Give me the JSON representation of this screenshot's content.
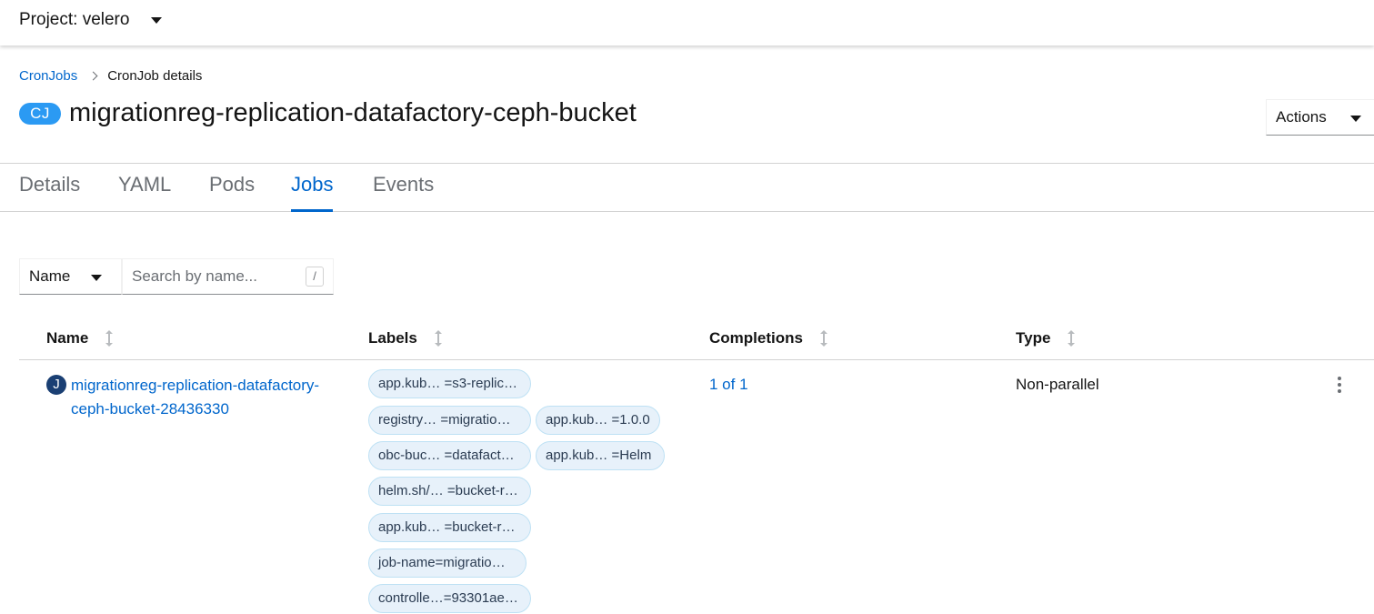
{
  "project": {
    "label": "Project: velero"
  },
  "breadcrumb": {
    "parent": "CronJobs",
    "current": "CronJob details"
  },
  "resource": {
    "badge": "CJ",
    "title": "migrationreg-replication-datafactory-ceph-bucket"
  },
  "actions": {
    "label": "Actions"
  },
  "tabs": [
    {
      "label": "Details"
    },
    {
      "label": "YAML"
    },
    {
      "label": "Pods"
    },
    {
      "label": "Jobs",
      "active": true
    },
    {
      "label": "Events"
    }
  ],
  "filter": {
    "type": "Name",
    "placeholder": "Search by name...",
    "shortcut": "/"
  },
  "table": {
    "columns": {
      "name": "Name",
      "labels": "Labels",
      "completions": "Completions",
      "type": "Type"
    },
    "rows": [
      {
        "icon": "J",
        "name_line1": "migrationreg-replication-datafactory-",
        "name_line2": "ceph-bucket-28436330",
        "labels": [
          "app.kub… =s3-replic…",
          "registry… =migratio…",
          "app.kub… =1.0.0",
          "obc-buc… =datafact…",
          "app.kub… =Helm",
          "helm.sh/… =bucket-r…",
          "app.kub… =bucket-r…",
          "job-name=migratio…",
          "controlle…=93301ae…"
        ],
        "completions": "1 of 1",
        "type": "Non-parallel"
      }
    ]
  },
  "colors": {
    "link": "#0066cc",
    "badge": "#2b9af3",
    "chip_bg": "#e7f1fa",
    "chip_border": "#bee1f4",
    "job_icon": "#1a3f73"
  }
}
